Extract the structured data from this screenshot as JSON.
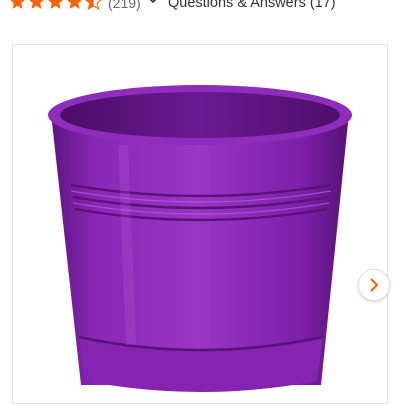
{
  "rating": {
    "value": 4.5,
    "max": 5,
    "review_count": "(219)",
    "star_color": "#f96302"
  },
  "questions": {
    "label": "Questions & Answers (17)"
  },
  "product_image": {
    "alt": "Purple flower planter pot",
    "color": "#7b1fa2"
  },
  "carousel": {
    "next_icon": "chevron-right-icon"
  }
}
